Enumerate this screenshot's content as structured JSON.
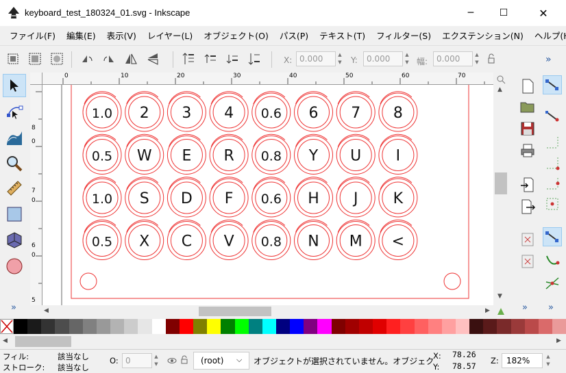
{
  "window": {
    "title": "keyboard_test_180324_01.svg - Inkscape",
    "minimize": "─",
    "maximize": "☐",
    "close": "✕"
  },
  "menu": [
    "ファイル(F)",
    "編集(E)",
    "表示(V)",
    "レイヤー(L)",
    "オブジェクト(O)",
    "パス(P)",
    "テキスト(T)",
    "フィルター(S)",
    "エクステンション(N)",
    "ヘルプ(H)"
  ],
  "toolbar": {
    "x_label": "X:",
    "x_value": "0.000",
    "y_label": "Y:",
    "y_value": "0.000",
    "w_label": "幅:",
    "w_value": "0.000",
    "more": "»"
  },
  "ruler": {
    "h_labels": [
      "0",
      "10",
      "20",
      "30",
      "40",
      "50",
      "60",
      "70"
    ],
    "v_labels": [
      "8",
      "0",
      "7",
      "0",
      "6",
      "0",
      "5"
    ]
  },
  "keys": [
    [
      "1.0",
      "2",
      "3",
      "4",
      "0.6",
      "6",
      "7",
      "8"
    ],
    [
      "0.5",
      "W",
      "E",
      "R",
      "0.8",
      "Y",
      "U",
      "I"
    ],
    [
      "1.0",
      "S",
      "D",
      "F",
      "0.6",
      "H",
      "J",
      "K"
    ],
    [
      "0.5",
      "X",
      "C",
      "V",
      "0.8",
      "N",
      "M",
      "<"
    ]
  ],
  "palette": [
    "#000000",
    "#1a1a1a",
    "#333333",
    "#4d4d4d",
    "#666666",
    "#808080",
    "#999999",
    "#b3b3b3",
    "#cccccc",
    "#e6e6e6",
    "#ffffff",
    "#800000",
    "#ff0000",
    "#808000",
    "#ffff00",
    "#008000",
    "#00ff00",
    "#008080",
    "#00ffff",
    "#000080",
    "#0000ff",
    "#800080",
    "#ff00ff",
    "#800000",
    "#a00000",
    "#c00000",
    "#e00000",
    "#ff2020",
    "#ff4040",
    "#ff6060",
    "#ff8080",
    "#ffa0a0",
    "#ffc0c0",
    "#3a1010",
    "#5a1a1a",
    "#7a2a2a",
    "#9a3a3a",
    "#ba4a4a",
    "#da6a6a",
    "#ea9a9a"
  ],
  "status": {
    "fill_label": "フィル:",
    "fill_value": "該当なし",
    "stroke_label": "ストローク:",
    "stroke_value": "該当なし",
    "opacity_label": "O:",
    "opacity_value": "0",
    "layer": "(root)",
    "message": "オブジェクトが選択されていません。オブジェク",
    "x_label": "X:",
    "x_value": "78.26",
    "y_label": "Y:",
    "y_value": "78.57",
    "zoom_label": "Z:",
    "zoom_value": "182%"
  },
  "colors": {
    "accent_red": "#ee3333",
    "selection_blue": "#cce4f7"
  }
}
